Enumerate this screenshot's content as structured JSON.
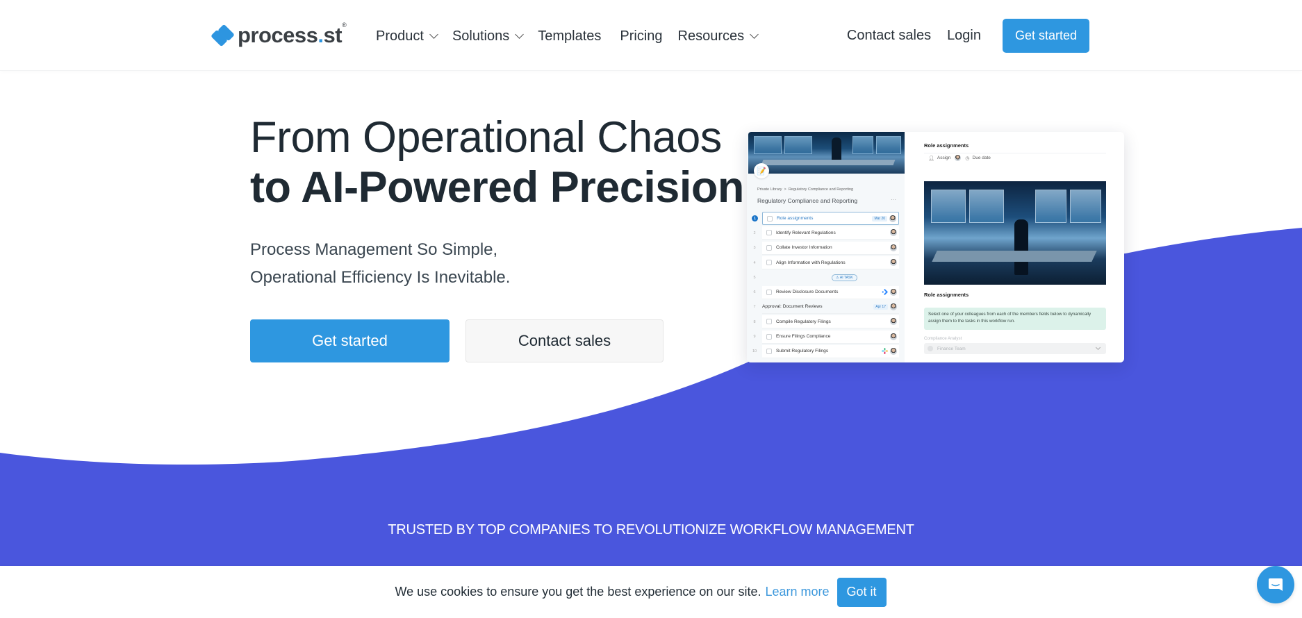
{
  "header": {
    "logo_text": "process",
    "logo_dot": ".",
    "logo_suffix": "st",
    "logo_reg": "®",
    "nav": [
      {
        "label": "Product",
        "dropdown": true
      },
      {
        "label": "Solutions",
        "dropdown": true
      },
      {
        "label": "Templates",
        "dropdown": false
      },
      {
        "label": "Pricing",
        "dropdown": false
      },
      {
        "label": "Resources",
        "dropdown": true
      }
    ],
    "contact_sales": "Contact sales",
    "login": "Login",
    "get_started": "Get started"
  },
  "hero": {
    "title_line1": "From Operational Chaos",
    "title_line2": "to AI-Powered Precision",
    "subtitle_line1": "Process Management So Simple,",
    "subtitle_line2": "Operational Efficiency Is Inevitable.",
    "primary_cta": "Get started",
    "secondary_cta": "Contact sales"
  },
  "product_preview": {
    "breadcrumb_library": "Private Library",
    "breadcrumb_sep": ">",
    "breadcrumb_template": "Regulatory Compliance and Reporting",
    "template_title": "Regulatory Compliance and Reporting",
    "more": "···",
    "tasks": [
      {
        "num": "1",
        "label": "Role assignments",
        "date": "Mar 20",
        "active": true,
        "checkbox": true
      },
      {
        "num": "2",
        "label": "Identify Relevant Regulations",
        "date": "",
        "active": false,
        "checkbox": true
      },
      {
        "num": "3",
        "label": "Collate Investor Information",
        "date": "",
        "active": false,
        "checkbox": true
      },
      {
        "num": "4",
        "label": "Align Information with Regulations",
        "date": "",
        "active": false,
        "checkbox": true
      },
      {
        "num": "5",
        "label": "AI TASK",
        "date": "",
        "active": false,
        "checkbox": false,
        "ai": true
      },
      {
        "num": "6",
        "label": "Review Disclosure Documents",
        "date": "",
        "active": false,
        "checkbox": true,
        "app": "jira"
      },
      {
        "num": "7",
        "label": "Approval: Document Reviews",
        "date": "Apr 17",
        "active": false,
        "checkbox": false
      },
      {
        "num": "8",
        "label": "Compile Regulatory Filings",
        "date": "",
        "active": false,
        "checkbox": true
      },
      {
        "num": "9",
        "label": "Ensure Filings Compliance",
        "date": "",
        "active": false,
        "checkbox": true
      },
      {
        "num": "10",
        "label": "Submit Regulatory Filings",
        "date": "",
        "active": false,
        "checkbox": true,
        "app": "slack"
      }
    ],
    "detail": {
      "title": "Role assignments",
      "assign": "Assign",
      "due_date": "Due date",
      "section_title": "Role assignments",
      "note": "Select one of your colleagues from each of the members fields below to dynamically assign them to the tasks in this workflow run.",
      "field_label": "Compliance Analyst",
      "field_value": "Finance Team"
    }
  },
  "trusted": {
    "text": "TRUSTED BY TOP COMPANIES TO REVOLUTIONIZE WORKFLOW MANAGEMENT"
  },
  "cookie": {
    "text": "We use cookies to ensure you get the best experience on our site.",
    "learn_more": "Learn more",
    "accept": "Got it"
  },
  "colors": {
    "brand_blue": "#2e97e0",
    "wave_indigo": "#4a56dd",
    "text_dark": "#1f2a33"
  }
}
